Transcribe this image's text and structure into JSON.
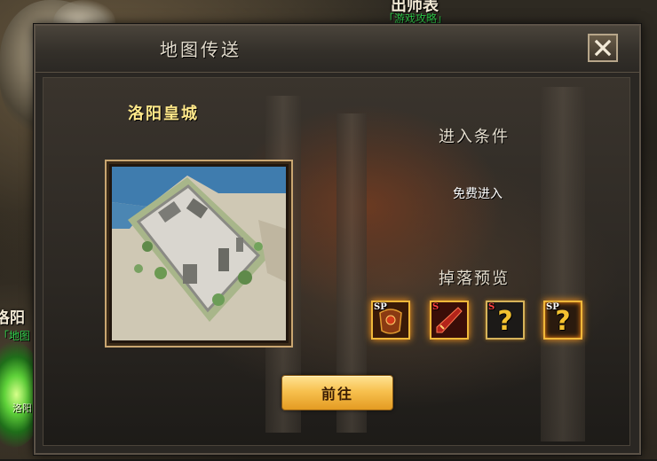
{
  "world": {
    "npc_top_name": "出师表",
    "npc_top_sub": "「游戏攻略」",
    "npc_left_name": "洛阳",
    "npc_left_sub": "「地图",
    "portal_label": "洛阳"
  },
  "dialog": {
    "title": "地图传送",
    "close_icon": "close-icon",
    "map": {
      "name": "洛阳皇城"
    },
    "conditions": {
      "title": "进入条件",
      "value": "免费进入"
    },
    "drops": {
      "title": "掉落预览",
      "items": [
        {
          "badge": "SP",
          "icon": "sp-armor-icon"
        },
        {
          "badge": "S",
          "icon": "s-weapon-icon"
        },
        {
          "badge": "S",
          "icon": "mystery-item-icon"
        },
        {
          "badge": "SP",
          "icon": "mystery-item-icon"
        }
      ]
    },
    "go_button": "前往"
  },
  "colors": {
    "map_name": "#ffe88a",
    "button_gold": "#f7c14f",
    "frame": "#5b5247"
  }
}
